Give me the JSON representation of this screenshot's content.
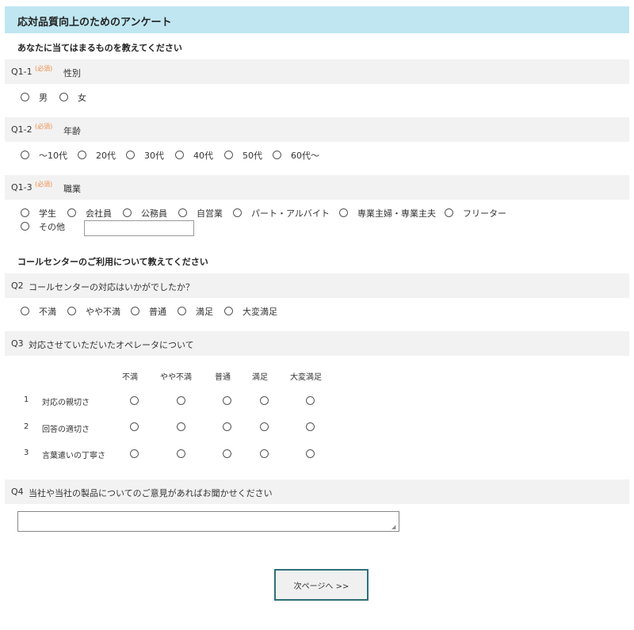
{
  "header": {
    "title": "応対品質向上のためのアンケート"
  },
  "sections": {
    "profile": "あなたに当てはまるものを教えてください",
    "callcenter": "コールセンターのご利用について教えてください"
  },
  "required_mark": "(必須)",
  "q1_1": {
    "id": "Q1-1",
    "label": "性別",
    "options": [
      "男",
      "女"
    ]
  },
  "q1_2": {
    "id": "Q1-2",
    "label": "年齢",
    "options": [
      "～10代",
      "20代",
      "30代",
      "40代",
      "50代",
      "60代～"
    ]
  },
  "q1_3": {
    "id": "Q1-3",
    "label": "職業",
    "options": [
      "学生",
      "会社員",
      "公務員",
      "自営業",
      "パート・アルバイト",
      "専業主婦・専業主夫",
      "フリーター"
    ],
    "other_label": "その他",
    "other_value": ""
  },
  "q2": {
    "id": "Q2",
    "label": "コールセンターの対応はいかがでしたか？",
    "options": [
      "不満",
      "やや不満",
      "普通",
      "満足",
      "大変満足"
    ]
  },
  "q3": {
    "id": "Q3",
    "label": "対応させていただいたオペレータについて",
    "columns": [
      "不満",
      "やや不満",
      "普通",
      "満足",
      "大変満足"
    ],
    "rows": [
      {
        "num": "1",
        "label": "対応の親切さ"
      },
      {
        "num": "2",
        "label": "回答の適切さ"
      },
      {
        "num": "3",
        "label": "言葉遣いの丁寧さ"
      }
    ]
  },
  "q4": {
    "id": "Q4",
    "label": "当社や当社の製品についてのご意見があればお聞かせください",
    "value": ""
  },
  "next_button": {
    "label": "次ページへ >>"
  }
}
